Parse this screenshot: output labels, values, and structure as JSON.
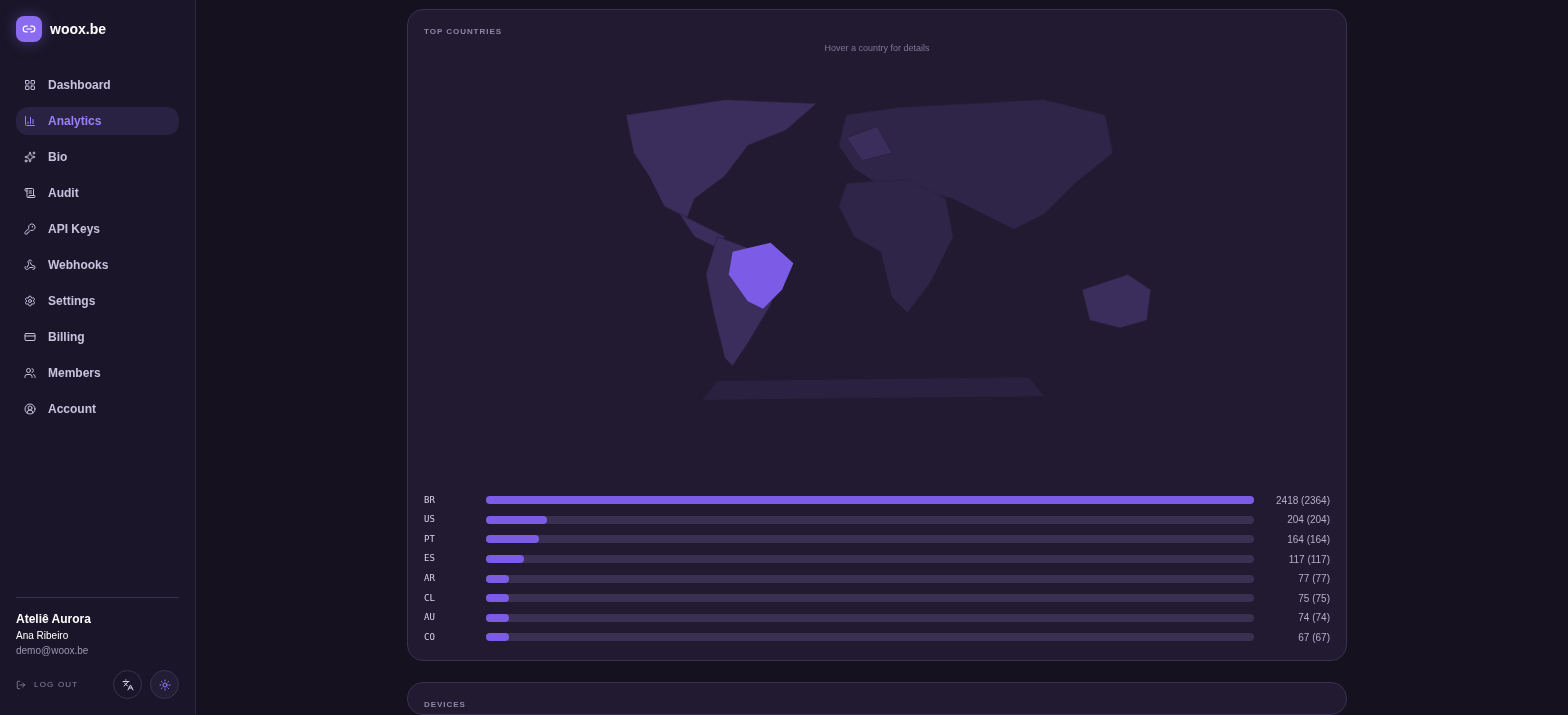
{
  "brand": {
    "name": "woox.be"
  },
  "nav": [
    {
      "label": "Dashboard",
      "kind": "dashboard",
      "selected": false
    },
    {
      "label": "Analytics",
      "kind": "chart",
      "selected": true
    },
    {
      "label": "Bio",
      "kind": "sparkle",
      "selected": false
    },
    {
      "label": "Audit",
      "kind": "scroll",
      "selected": false
    },
    {
      "label": "API Keys",
      "kind": "key",
      "selected": false
    },
    {
      "label": "Webhooks",
      "kind": "webhook",
      "selected": false
    },
    {
      "label": "Settings",
      "kind": "settings",
      "selected": false
    },
    {
      "label": "Billing",
      "kind": "card",
      "selected": false
    },
    {
      "label": "Members",
      "kind": "users",
      "selected": false
    },
    {
      "label": "Account",
      "kind": "account",
      "selected": false
    }
  ],
  "user": {
    "workspace": "Ateliê Aurora",
    "name": "Ana Ribeiro",
    "email": "demo@woox.be",
    "logout": "LOG OUT"
  },
  "countries": {
    "title": "TOP COUNTRIES",
    "map_hint": "Hover a country for details",
    "rows": [
      {
        "code": "BR",
        "level": 1,
        "reading": "2418 (2364)"
      },
      {
        "code": "US",
        "level": 0.08,
        "reading": "204 (204)"
      },
      {
        "code": "PT",
        "level": 0.069,
        "reading": "164 (164)"
      },
      {
        "code": "ES",
        "level": 0.05,
        "reading": "117 (117)"
      },
      {
        "code": "AR",
        "level": 0.03,
        "reading": "77 (77)"
      },
      {
        "code": "CL",
        "level": 0.03,
        "reading": "75 (75)"
      },
      {
        "code": "AU",
        "level": 0.03,
        "reading": "74 (74)"
      },
      {
        "code": "CO",
        "level": 0.03,
        "reading": "67 (67)"
      }
    ]
  },
  "devices": {
    "title": "DEVICES"
  }
}
